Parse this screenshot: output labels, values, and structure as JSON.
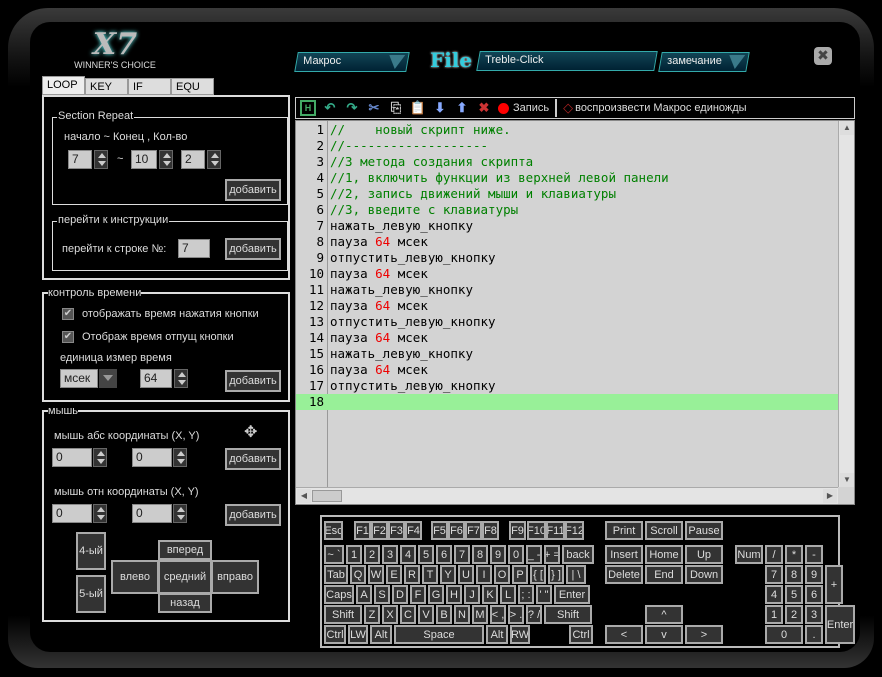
{
  "logo": {
    "text": "X7",
    "tagline": "Winner's Choice"
  },
  "header": {
    "mode_select": "Макрос",
    "file_label": "File",
    "file_name": "Treble-Click",
    "note_select": "замечание",
    "close_icon": "close-icon"
  },
  "tabs": [
    {
      "label": "LOOP",
      "active": true
    },
    {
      "label": "KEY"
    },
    {
      "label": "IF"
    },
    {
      "label": "EQU"
    }
  ],
  "loop": {
    "section_title": "Section Repeat",
    "range_label": "начало ~ Конец , Кол-во",
    "start": "7",
    "tilde": "~",
    "end": "10",
    "count": "2",
    "add": "добавить",
    "goto_title": "перейти к инструкции",
    "goto_label": "перейти к строке №:",
    "goto_value": "7",
    "goto_add": "добавить"
  },
  "time": {
    "title": "контроль времени",
    "show_press": "отображать время нажатия кнопки",
    "show_press_checked": true,
    "show_release": "Отображ время отпущ кнопки",
    "show_release_checked": true,
    "unit_label": "единица измер  время",
    "unit": "мсек",
    "value": "64",
    "add": "добавить"
  },
  "mouse": {
    "title": "мышь",
    "abs_label": "мышь абс координаты (X, Y)",
    "abs_x": "0",
    "abs_y": "0",
    "abs_add": "добавить",
    "rel_label": "мышь отн координаты (X, Y)",
    "rel_x": "0",
    "rel_y": "0",
    "rel_add": "добавить",
    "b4": "4-ый",
    "b5": "5-ый",
    "forward": "вперед",
    "left": "влево",
    "middle": "средний",
    "right": "вправо",
    "back": "назад"
  },
  "toolbar": {
    "record": "Запись",
    "play_once": "воспроизвести Макрос единожды",
    "accent_record": "#ff0000"
  },
  "code": [
    [
      [
        "c",
        "//    новый скрипт ниже."
      ]
    ],
    [
      [
        "c",
        "//-------------------"
      ]
    ],
    [
      [
        "c",
        "//3 метода создания скрипта"
      ]
    ],
    [
      [
        "c",
        "//1, включить функции из верхней левой панели"
      ]
    ],
    [
      [
        "c",
        "//2, запись движений мыши и клавиатуры"
      ]
    ],
    [
      [
        "c",
        "//3, введите с клавиатуры"
      ]
    ],
    [
      [
        "t",
        "нажать_левую_кнопку"
      ]
    ],
    [
      [
        "t",
        "пауза "
      ],
      [
        "n",
        "64"
      ],
      [
        "t",
        " мсек"
      ]
    ],
    [
      [
        "t",
        "отпустить_левую_кнопку"
      ]
    ],
    [
      [
        "t",
        "пауза "
      ],
      [
        "n",
        "64"
      ],
      [
        "t",
        " мсек"
      ]
    ],
    [
      [
        "t",
        "нажать_левую_кнопку"
      ]
    ],
    [
      [
        "t",
        "пауза "
      ],
      [
        "n",
        "64"
      ],
      [
        "t",
        " мсек"
      ]
    ],
    [
      [
        "t",
        "отпустить_левую_кнопку"
      ]
    ],
    [
      [
        "t",
        "пауза "
      ],
      [
        "n",
        "64"
      ],
      [
        "t",
        " мсек"
      ]
    ],
    [
      [
        "t",
        "нажать_левую_кнопку"
      ]
    ],
    [
      [
        "t",
        "пауза "
      ],
      [
        "n",
        "64"
      ],
      [
        "t",
        " мсек"
      ]
    ],
    [
      [
        "t",
        "отпустить_левую_кнопку"
      ]
    ],
    [
      [
        "t",
        ""
      ]
    ]
  ],
  "current_line": 18,
  "keyboard": {
    "main": [
      [
        "Esc",
        "F1",
        "F2",
        "F3",
        "F4",
        "F5",
        "F6",
        "F7",
        "F8",
        "F9",
        "F10",
        "F11",
        "F12"
      ],
      [
        "~ `",
        "1",
        "2",
        "3",
        "4",
        "5",
        "6",
        "7",
        "8",
        "9",
        "0",
        "_ -",
        "+ =",
        "back"
      ],
      [
        "Tab",
        "Q",
        "W",
        "E",
        "R",
        "T",
        "Y",
        "U",
        "I",
        "O",
        "P",
        "{ [",
        "} ]",
        "| \\"
      ],
      [
        "Caps",
        "A",
        "S",
        "D",
        "F",
        "G",
        "H",
        "J",
        "K",
        "L",
        "; :",
        "' \"",
        "Enter"
      ],
      [
        "Shift",
        "Z",
        "X",
        "C",
        "V",
        "B",
        "N",
        "M",
        "< ,",
        "> .",
        "? /",
        "Shift"
      ],
      [
        "Ctrl",
        "LW",
        "Alt",
        "Space",
        "Alt",
        "RW",
        "Ctrl"
      ]
    ],
    "nav": [
      "Print",
      "Scroll",
      "Pause",
      "Insert",
      "Home",
      "Up",
      "Delete",
      "End",
      "Down",
      "^",
      "<",
      "v",
      ">"
    ],
    "numpad": [
      "Num",
      "/",
      "*",
      "-",
      "7",
      "8",
      "9",
      "+",
      "4",
      "5",
      "6",
      "1",
      "2",
      "3",
      "Enter",
      "0",
      "."
    ]
  }
}
